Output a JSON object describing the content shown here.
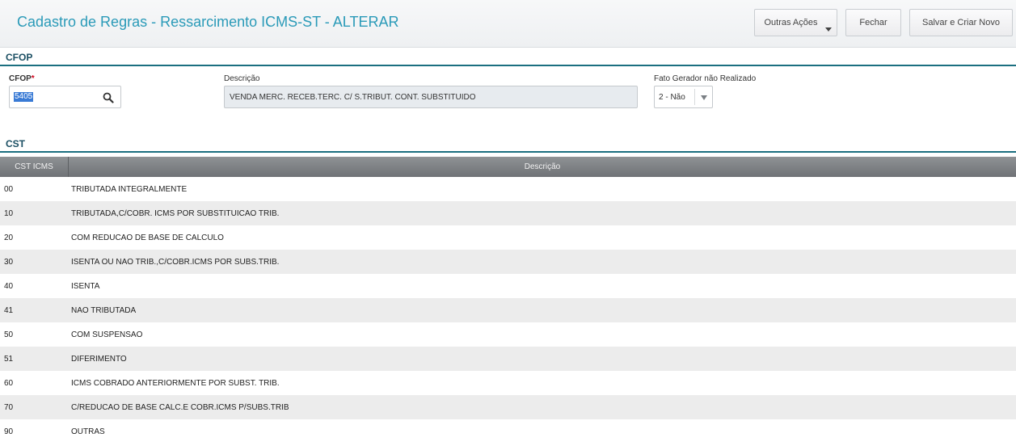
{
  "header": {
    "title": "Cadastro de Regras - Ressarcimento ICMS-ST - ALTERAR",
    "buttons": {
      "outras": "Outras Ações",
      "fechar": "Fechar",
      "salvar": "Salvar e Criar Novo"
    }
  },
  "cfop_section": {
    "title": "CFOP",
    "cfop_label": "CFOP",
    "required_mark": "*",
    "cfop_value": "5405",
    "descricao_label": "Descrição",
    "descricao_value": "VENDA MERC. RECEB.TERC. C/ S.TRIBUT. CONT. SUBSTITUIDO",
    "fato_label": "Fato Gerador não Realizado",
    "fato_value": "2 - Não"
  },
  "cst_section": {
    "title": "CST",
    "columns": [
      "CST ICMS",
      "Descrição"
    ],
    "rows": [
      {
        "cst": "00",
        "desc": "TRIBUTADA INTEGRALMENTE"
      },
      {
        "cst": "10",
        "desc": "TRIBUTADA,C/COBR. ICMS POR SUBSTITUICAO TRIB."
      },
      {
        "cst": "20",
        "desc": "COM REDUCAO DE BASE DE CALCULO"
      },
      {
        "cst": "30",
        "desc": "ISENTA OU NAO TRIB.,C/COBR.ICMS POR SUBS.TRIB."
      },
      {
        "cst": "40",
        "desc": "ISENTA"
      },
      {
        "cst": "41",
        "desc": "NAO TRIBUTADA"
      },
      {
        "cst": "50",
        "desc": "COM SUSPENSAO"
      },
      {
        "cst": "51",
        "desc": "DIFERIMENTO"
      },
      {
        "cst": "60",
        "desc": "ICMS COBRADO ANTERIORMENTE POR SUBST. TRIB."
      },
      {
        "cst": "70",
        "desc": "C/REDUCAO DE BASE CALC.E COBR.ICMS P/SUBS.TRIB"
      },
      {
        "cst": "90",
        "desc": "OUTRAS"
      }
    ]
  },
  "icons": {
    "search": "search-icon",
    "dropdown": "chevron-down-icon"
  },
  "colors": {
    "title": "#2a9ab8",
    "section_line": "#1b6f80",
    "selection": "#3a7bd5"
  }
}
